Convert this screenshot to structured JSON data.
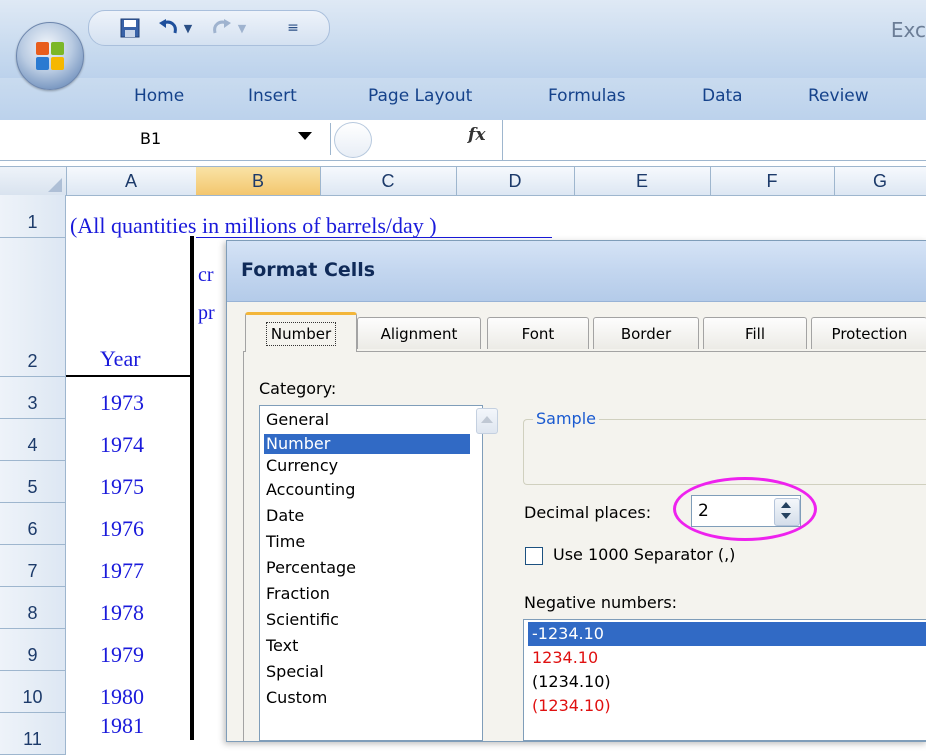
{
  "window": {
    "app_title": "Exc"
  },
  "ribbon": {
    "tabs": [
      "Home",
      "Insert",
      "Page Layout",
      "Formulas",
      "Data",
      "Review"
    ]
  },
  "formula_bar": {
    "name_box": "B1",
    "fx": "fx",
    "formula": ""
  },
  "grid": {
    "columns": [
      "A",
      "B",
      "C",
      "D",
      "E",
      "F",
      "G"
    ],
    "selected_column": "B",
    "rows": [
      "1",
      "2",
      "3",
      "4",
      "5",
      "6",
      "7",
      "8",
      "9",
      "10",
      "11"
    ],
    "note": "(All quantities in millions of barrels/day )",
    "header_cell": "Year",
    "years": [
      "1973",
      "1974",
      "1975",
      "1976",
      "1977",
      "1978",
      "1979",
      "1980",
      "1981"
    ],
    "bleed_text": [
      "cr",
      "pr"
    ]
  },
  "dialog": {
    "title": "Format Cells",
    "tabs": [
      "Number",
      "Alignment",
      "Font",
      "Border",
      "Fill",
      "Protection"
    ],
    "active_tab": "Number",
    "category_label": "Category:",
    "categories": [
      "General",
      "Number",
      "Currency",
      "Accounting",
      "Date",
      "Time",
      "Percentage",
      "Fraction",
      "Scientific",
      "Text",
      "Special",
      "Custom"
    ],
    "selected_category": "Number",
    "sample_label": "Sample",
    "sample_value": "",
    "decimal_label": "Decimal places:",
    "decimal_value": "2",
    "separator_label": "Use 1000 Separator (,)",
    "separator_checked": false,
    "negative_label": "Negative numbers:",
    "negative_options": [
      "-1234.10",
      "1234.10",
      "(1234.10)",
      "(1234.10)"
    ],
    "selected_negative": "-1234.10",
    "colors": {
      "red": "#e01010",
      "selection": "#316ac5",
      "highlight": "#ee22ee"
    }
  }
}
